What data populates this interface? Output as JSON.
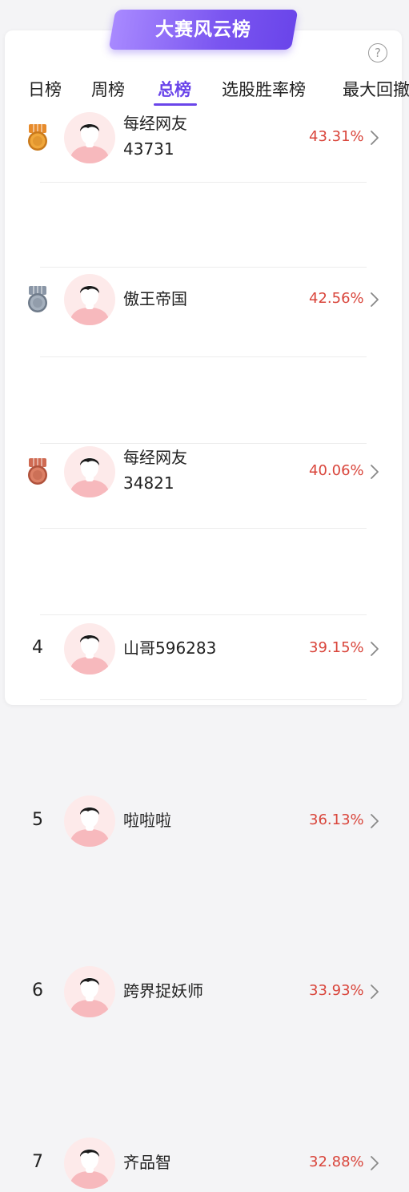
{
  "banner": {
    "title": "大赛风云榜"
  },
  "help": {
    "glyph": "?"
  },
  "tabs": [
    {
      "label": "日榜",
      "active": false
    },
    {
      "label": "周榜",
      "active": false
    },
    {
      "label": "总榜",
      "active": true
    },
    {
      "label": "选股胜率榜",
      "active": false
    },
    {
      "label": "最大回撤",
      "active": false
    }
  ],
  "colors": {
    "accent": "#6a45ea",
    "percent": "#d9453b",
    "gold": "#e8a23a",
    "silver": "#8a96a6",
    "bronze": "#d0705a"
  },
  "rankings": [
    {
      "rank": "1",
      "medal": "gold-medal",
      "name_line1": "每经网友",
      "name_line2": "43731",
      "percent": "43.31%"
    },
    {
      "rank": "2",
      "medal": "silver-medal",
      "name_line1": "傲王帝国",
      "name_line2": "",
      "percent": "42.56%"
    },
    {
      "rank": "3",
      "medal": "bronze-medal",
      "name_line1": "每经网友",
      "name_line2": "34821",
      "percent": "40.06%"
    },
    {
      "rank": "4",
      "medal": "",
      "name_line1": "山哥596283",
      "name_line2": "",
      "percent": "39.15%"
    },
    {
      "rank": "5",
      "medal": "",
      "name_line1": "啦啦啦",
      "name_line2": "",
      "percent": "36.13%"
    },
    {
      "rank": "6",
      "medal": "",
      "name_line1": "跨界捉妖师",
      "name_line2": "",
      "percent": "33.93%"
    },
    {
      "rank": "7",
      "medal": "",
      "name_line1": "齐品智",
      "name_line2": "",
      "percent": "32.88%"
    }
  ]
}
